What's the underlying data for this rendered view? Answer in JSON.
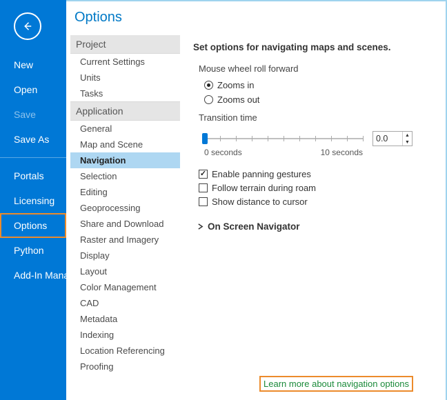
{
  "rail": {
    "items": [
      {
        "label": "New"
      },
      {
        "label": "Open"
      },
      {
        "label": "Save",
        "disabled": true
      },
      {
        "label": "Save As"
      }
    ],
    "items2": [
      {
        "label": "Portals"
      },
      {
        "label": "Licensing"
      },
      {
        "label": "Options",
        "selected": true
      },
      {
        "label": "Python"
      },
      {
        "label": "Add-In Manager"
      }
    ]
  },
  "dialog": {
    "title": "Options",
    "tree": {
      "groups": [
        {
          "header": "Project",
          "items": [
            "Current Settings",
            "Units",
            "Tasks"
          ]
        },
        {
          "header": "Application",
          "items": [
            "General",
            "Map and Scene",
            "Navigation",
            "Selection",
            "Editing",
            "Geoprocessing",
            "Share and Download",
            "Raster and Imagery",
            "Display",
            "Layout",
            "Color Management",
            "CAD",
            "Metadata",
            "Indexing",
            "Location Referencing",
            "Proofing"
          ],
          "selected": "Navigation"
        }
      ]
    },
    "content": {
      "heading": "Set options for navigating maps and scenes.",
      "mouseWheel": {
        "label": "Mouse wheel roll forward",
        "opt1": "Zooms in",
        "opt2": "Zooms out",
        "selected": "Zooms in"
      },
      "transition": {
        "label": "Transition time",
        "min": "0 seconds",
        "max": "10 seconds",
        "value": "0.0"
      },
      "checks": {
        "panning": {
          "label": "Enable panning gestures",
          "checked": true
        },
        "terrain": {
          "label": "Follow terrain during roam",
          "checked": false
        },
        "distance": {
          "label": "Show distance to cursor",
          "checked": false
        }
      },
      "expander": "On Screen Navigator",
      "learn": "Learn more about navigation options"
    }
  }
}
